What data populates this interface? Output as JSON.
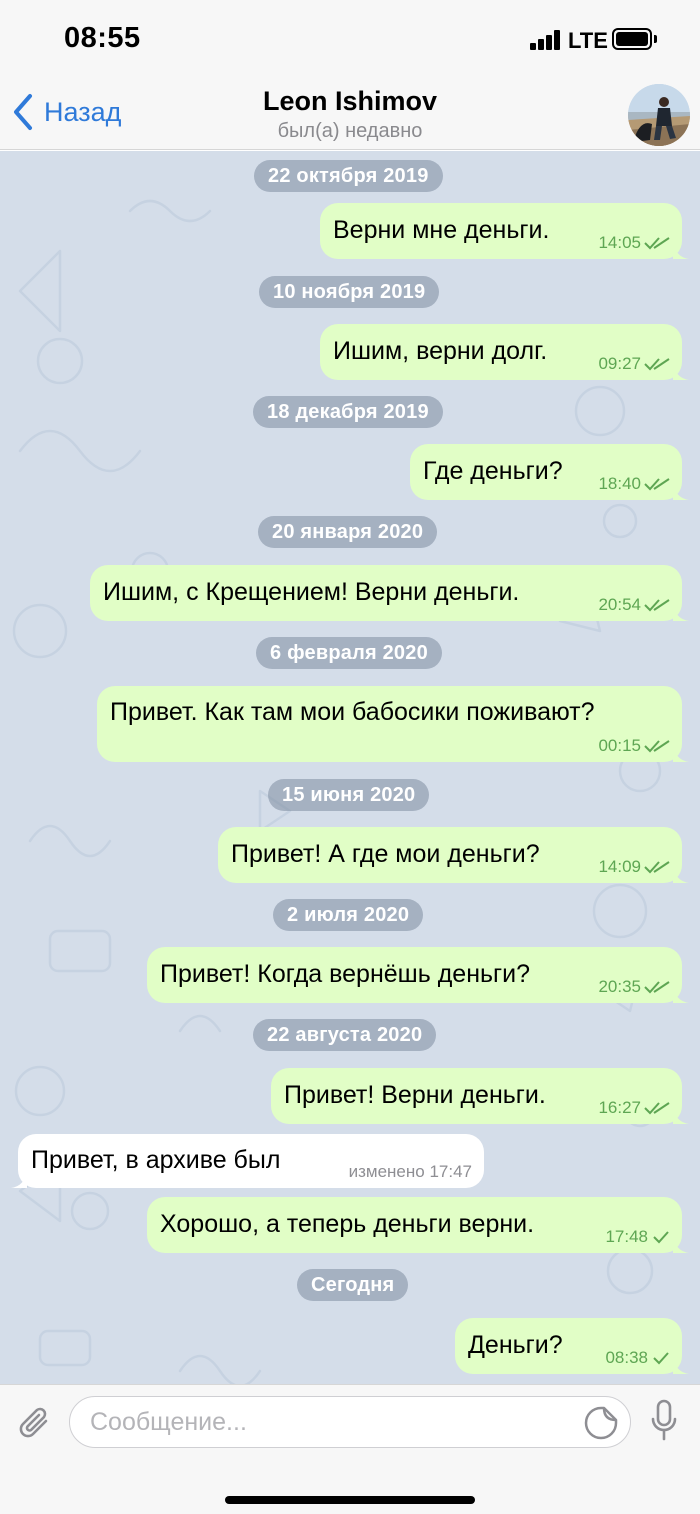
{
  "status_bar": {
    "time": "08:55",
    "network": "LTE"
  },
  "header": {
    "back_label": "Назад",
    "contact_name": "Leon Ishimov",
    "contact_status": "был(а) недавно"
  },
  "messages": [
    {
      "type": "date",
      "label": "22 октября 2019"
    },
    {
      "type": "out",
      "text": "Верни мне деньги.",
      "time": "14:05",
      "read": true
    },
    {
      "type": "date",
      "label": "10 ноября 2019"
    },
    {
      "type": "out",
      "text": "Ишим, верни долг.",
      "time": "09:27",
      "read": true
    },
    {
      "type": "date",
      "label": "18 декабря 2019"
    },
    {
      "type": "out",
      "text": "Где деньги?",
      "time": "18:40",
      "read": true
    },
    {
      "type": "date",
      "label": "20 января 2020"
    },
    {
      "type": "out",
      "text": "Ишим, с Крещением! Верни деньги.",
      "time": "20:54",
      "read": true
    },
    {
      "type": "date",
      "label": "6 февраля 2020"
    },
    {
      "type": "out",
      "text": "Привет. Как там мои бабосики поживают?",
      "time": "00:15",
      "read": true
    },
    {
      "type": "date",
      "label": "15 июня 2020"
    },
    {
      "type": "out",
      "text": "Привет! А где мои деньги?",
      "time": "14:09",
      "read": true
    },
    {
      "type": "date",
      "label": "2 июля 2020"
    },
    {
      "type": "out",
      "text": "Привет! Когда вернёшь деньги?",
      "time": "20:35",
      "read": true
    },
    {
      "type": "date",
      "label": "22 августа 2020"
    },
    {
      "type": "out",
      "text": "Привет! Верни деньги.",
      "time": "16:27",
      "read": true
    },
    {
      "type": "in",
      "text": "Привет, в архиве был",
      "edited_label": "изменено",
      "time": "17:47"
    },
    {
      "type": "out",
      "text": "Хорошо, а теперь деньги верни.",
      "time": "17:48",
      "read": false
    },
    {
      "type": "date",
      "label": "Сегодня"
    },
    {
      "type": "out",
      "text": "Деньги?",
      "time": "08:38",
      "read": false
    }
  ],
  "input": {
    "placeholder": "Сообщение..."
  },
  "icons": {
    "back": "chevron-left-icon",
    "attach": "paperclip-icon",
    "sticker": "sticker-icon",
    "mic": "microphone-icon"
  },
  "colors": {
    "accent": "#2f7ad9",
    "outgoing_bubble": "#e1fec6",
    "incoming_bubble": "#ffffff",
    "chat_background": "#d4dde9",
    "outgoing_meta": "#5ea653"
  }
}
